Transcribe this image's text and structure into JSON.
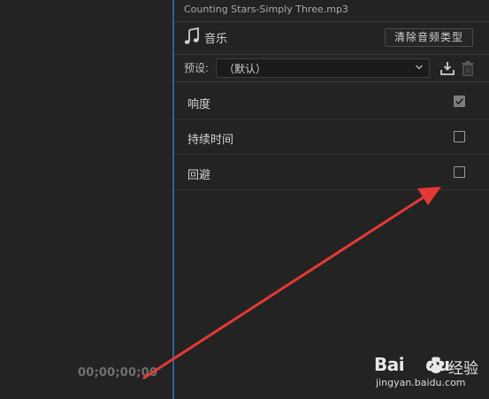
{
  "timeline": {
    "timecode": "00;00;00;00"
  },
  "panel": {
    "title": "Counting Stars-Simply Three.mp3",
    "audio_type": {
      "icon": "music-note-icon",
      "label": "音乐",
      "clear_button_label": "清除音频类型"
    },
    "preset": {
      "label": "预设:",
      "value": "（默认）",
      "icons": [
        "chevron-down-icon",
        "save-preset-icon",
        "delete-preset-icon"
      ]
    },
    "options": [
      {
        "label": "响度",
        "checked": true
      },
      {
        "label": "持续时间",
        "checked": false
      },
      {
        "label": "回避",
        "checked": false
      }
    ]
  },
  "annotation": {
    "arrow_color": "#e53935"
  },
  "watermark": {
    "logo_text": "Bai",
    "logo_text_2": "du",
    "brand": "经验",
    "url": "jingyan.baidu.com"
  },
  "colors": {
    "background": "#232323",
    "divider_accent": "#2f5f9e",
    "checkbox_checked": "#7c7c7c"
  }
}
